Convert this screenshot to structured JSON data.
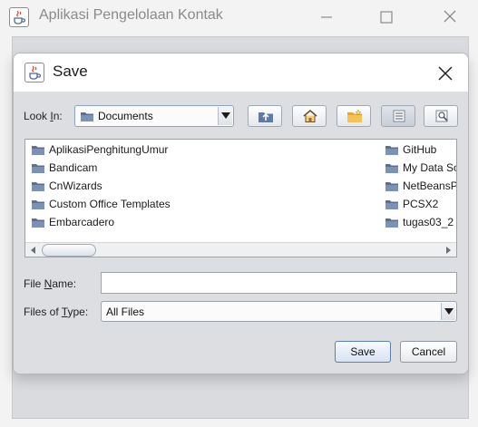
{
  "parent_window": {
    "title": "Aplikasi Pengelolaan Kontak",
    "icon": "java-cup-icon",
    "controls": [
      "minimize-icon",
      "maximize-icon",
      "close-icon"
    ]
  },
  "dialog": {
    "title": "Save",
    "icon": "java-cup-icon",
    "look_in": {
      "label_prefix": "Look ",
      "label_mnemonic": "I",
      "label_suffix": "n:",
      "value": "Documents"
    },
    "toolbar": [
      "up-folder-icon",
      "home-icon",
      "new-folder-icon",
      "list-view-icon",
      "details-view-icon"
    ],
    "files_col1": [
      "AplikasiPenghitungUmur",
      "Bandicam",
      "CnWizards",
      "Custom Office Templates",
      "Embarcadero"
    ],
    "files_col2": [
      "GitHub",
      "My Data So",
      "NetBeansP",
      "PCSX2",
      "tugas03_2"
    ],
    "file_name": {
      "label_prefix": "File ",
      "label_mnemonic": "N",
      "label_suffix": "ame:",
      "value": ""
    },
    "files_of_type": {
      "label_prefix": "Files of ",
      "label_mnemonic": "T",
      "label_suffix": "ype:",
      "value": "All Files"
    },
    "save_label": "Save",
    "cancel_label": "Cancel"
  }
}
